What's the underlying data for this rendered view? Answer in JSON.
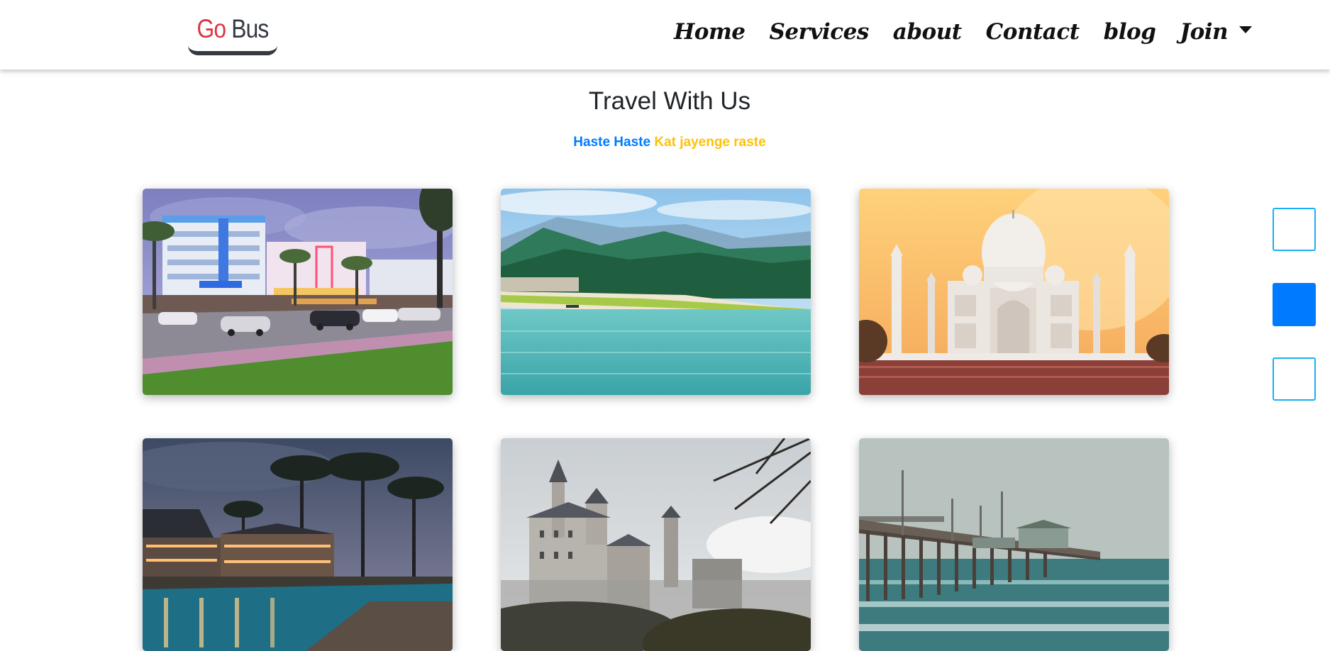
{
  "brand": {
    "first": "Go",
    "second": "Bus"
  },
  "nav": {
    "items": [
      {
        "label": "Home"
      },
      {
        "label": "Services"
      },
      {
        "label": "about"
      },
      {
        "label": "Contact"
      },
      {
        "label": "blog"
      },
      {
        "label": "Join"
      }
    ]
  },
  "hero": {
    "title": "Travel With Us",
    "tagline_part1": "Haste Haste",
    "tagline_part2": "Kat jayenge raste"
  },
  "colors": {
    "brand_go": "#dc3545",
    "brand_bus": "#343a40",
    "tagline_blue": "#007bff",
    "tagline_gold": "#ffc107",
    "indicator_border": "#17b0f5",
    "indicator_active": "#007bff"
  },
  "gallery": {
    "cards": [
      {
        "icon": "hotel-street-photo"
      },
      {
        "icon": "mountain-lake-photo"
      },
      {
        "icon": "taj-mahal-photo"
      },
      {
        "icon": "resort-pool-photo"
      },
      {
        "icon": "castle-photo"
      },
      {
        "icon": "pier-sea-photo"
      }
    ]
  },
  "side_indicators": {
    "count": 3,
    "active_index": 1
  }
}
